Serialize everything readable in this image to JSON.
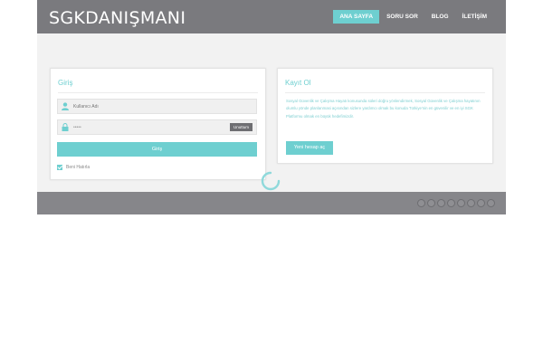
{
  "header": {
    "logo": "SGKDANIŞMANI",
    "nav": [
      {
        "label": "ANA SAYFA",
        "active": true
      },
      {
        "label": "SORU SOR",
        "active": false
      },
      {
        "label": "BLOG",
        "active": false
      },
      {
        "label": "İLETİŞİM",
        "active": false
      }
    ]
  },
  "login": {
    "title": "Giriş",
    "username_placeholder": "Kullanıcı Adı",
    "password_value": "•••••",
    "forgot_label": "Unuttum",
    "submit_label": "Giriş",
    "remember_label": "Beni Hatırla",
    "remember_checked": true
  },
  "register": {
    "title": "Kayıt Ol",
    "description": "Sosyal Güvenlik ve Çalışma Hayatı konusunda süleri doğru yönlendirmek, Sosyal Güvenlik ve Çalışma hayatının olumlu yönde planlanmasi açısından sizlere yardımcı olmak bu konuda Türkiye'nin en güvenilir ve en iyi SGK Platformu olmak en büyük hedefimizdir.",
    "button_label": "Yeni hesap aç"
  },
  "footer": {
    "social_icons": [
      "twitter-icon",
      "facebook-icon",
      "google-plus-icon",
      "pinterest-icon",
      "youtube-icon",
      "flickr-icon",
      "linkedin-icon",
      "rss-icon"
    ]
  },
  "colors": {
    "accent": "#6ecfd0",
    "header_bg": "#7a7a7e",
    "footer_bg": "#86868a"
  }
}
